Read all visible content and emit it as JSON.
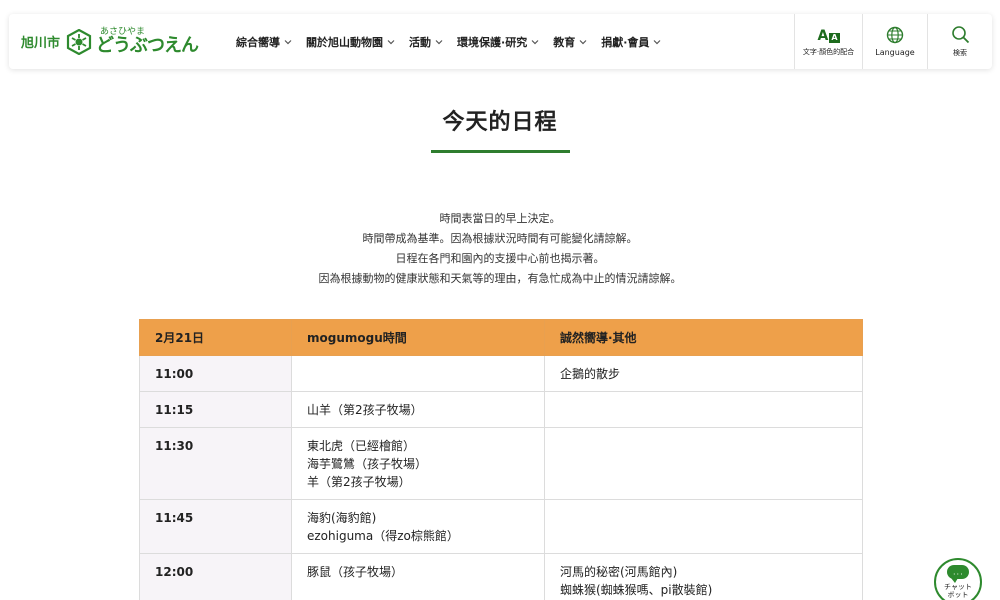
{
  "header": {
    "logo": {
      "city": "旭川市",
      "sub": "あさひやま",
      "main": "どうぶつえん"
    },
    "nav": [
      {
        "label": "綜合嚮導"
      },
      {
        "label": "關於旭山動物園"
      },
      {
        "label": "活動"
      },
      {
        "label": "環境保護·研究"
      },
      {
        "label": "教育"
      },
      {
        "label": "捐獻·會員"
      }
    ],
    "tools": {
      "color_label": "文字·顏色的配合",
      "language_label": "Language",
      "search_label": "検索"
    }
  },
  "page": {
    "title": "今天的日程",
    "notes": [
      "時間表當日的早上決定。",
      "時間帶成為基準。因為根據狀況時間有可能變化請諒解。",
      "日程在各門和園內的支援中心前也揭示著。",
      "因為根據動物的健康狀態和天氣等的理由，有急忙成為中止的情況請諒解。"
    ]
  },
  "schedule": {
    "headers": [
      "2月21日",
      "mogumogu時間",
      "誠然嚮導·其他"
    ],
    "rows": [
      {
        "time": "11:00",
        "mogumogu": [],
        "other": [
          "企鵝的散步"
        ]
      },
      {
        "time": "11:15",
        "mogumogu": [
          "山羊（第2孩子牧場）"
        ],
        "other": []
      },
      {
        "time": "11:30",
        "mogumogu": [
          "東北虎（已經檜館）",
          "海芋鷺鷥（孩子牧場）",
          "羊（第2孩子牧場）"
        ],
        "other": []
      },
      {
        "time": "11:45",
        "mogumogu": [
          "海豹(海豹館)",
          "ezohiguma（得zo棕熊館）"
        ],
        "other": []
      },
      {
        "time": "12:00",
        "mogumogu": [
          "豚鼠（孩子牧場）"
        ],
        "other": [
          "河馬的秘密(河馬館內)",
          "蜘蛛猴(蜘蛛猴嗎、pi散裝館)"
        ]
      }
    ]
  },
  "chatbot": {
    "label_line1": "チャット",
    "label_line2": "ボット"
  },
  "colors": {
    "brand_green": "#2e8a2e",
    "table_header": "#eea04a",
    "time_cell_bg": "#f7f4f8"
  },
  "icons": [
    "zoo-logo-icon",
    "chevron-down-icon",
    "text-size-icon",
    "globe-icon",
    "search-icon",
    "chat-bubble-icon"
  ]
}
